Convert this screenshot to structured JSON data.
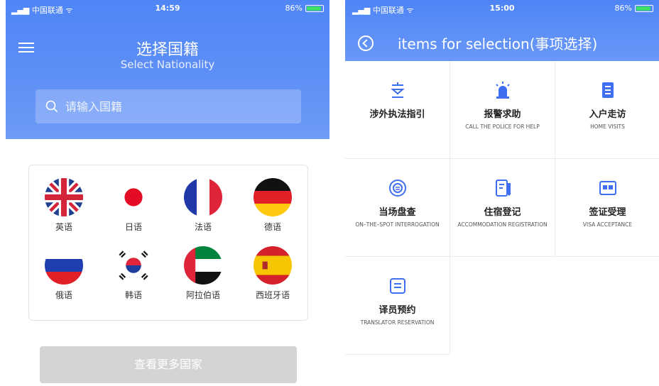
{
  "left": {
    "status": {
      "carrier": "中国联通",
      "time": "14:59",
      "battery": "86%"
    },
    "title_cn": "选择国籍",
    "title_en": "Select Nationality",
    "search_placeholder": "请输入国籍",
    "languages": [
      {
        "label": "英语",
        "flag": "uk"
      },
      {
        "label": "日语",
        "flag": "japan"
      },
      {
        "label": "法语",
        "flag": "france"
      },
      {
        "label": "德语",
        "flag": "germany"
      },
      {
        "label": "俄语",
        "flag": "russia"
      },
      {
        "label": "韩语",
        "flag": "korea"
      },
      {
        "label": "阿拉伯语",
        "flag": "uae"
      },
      {
        "label": "西班牙语",
        "flag": "spain"
      }
    ],
    "more_button": "查看更多国家"
  },
  "right": {
    "status": {
      "carrier": "中国联通",
      "time": "15:00",
      "battery": "86%"
    },
    "title": "items for selection(事项选择)",
    "items": [
      {
        "cn": "涉外执法指引",
        "en": "",
        "icon": "guide-icon"
      },
      {
        "cn": "报警求助",
        "en": "CALL THE POLICE FOR HELP",
        "icon": "alarm-light-icon"
      },
      {
        "cn": "入户走访",
        "en": "HOME VISITS",
        "icon": "document-icon"
      },
      {
        "cn": "当场盘查",
        "en": "ON–THE–SPOT INTERROGATION",
        "icon": "speech-bubble-icon"
      },
      {
        "cn": "住宿登记",
        "en": "ACCOMMODATION REGISTRATION",
        "icon": "registration-form-icon"
      },
      {
        "cn": "签证受理",
        "en": "VISA ACCEPTANCE",
        "icon": "id-card-icon"
      },
      {
        "cn": "译员预约",
        "en": "TRANSLATOR RESERVATION",
        "icon": "list-icon"
      }
    ]
  },
  "colors": {
    "header_blue": "#4f86f6",
    "icon_blue": "#3f6ff0",
    "disabled_button": "#d4d4d4"
  }
}
